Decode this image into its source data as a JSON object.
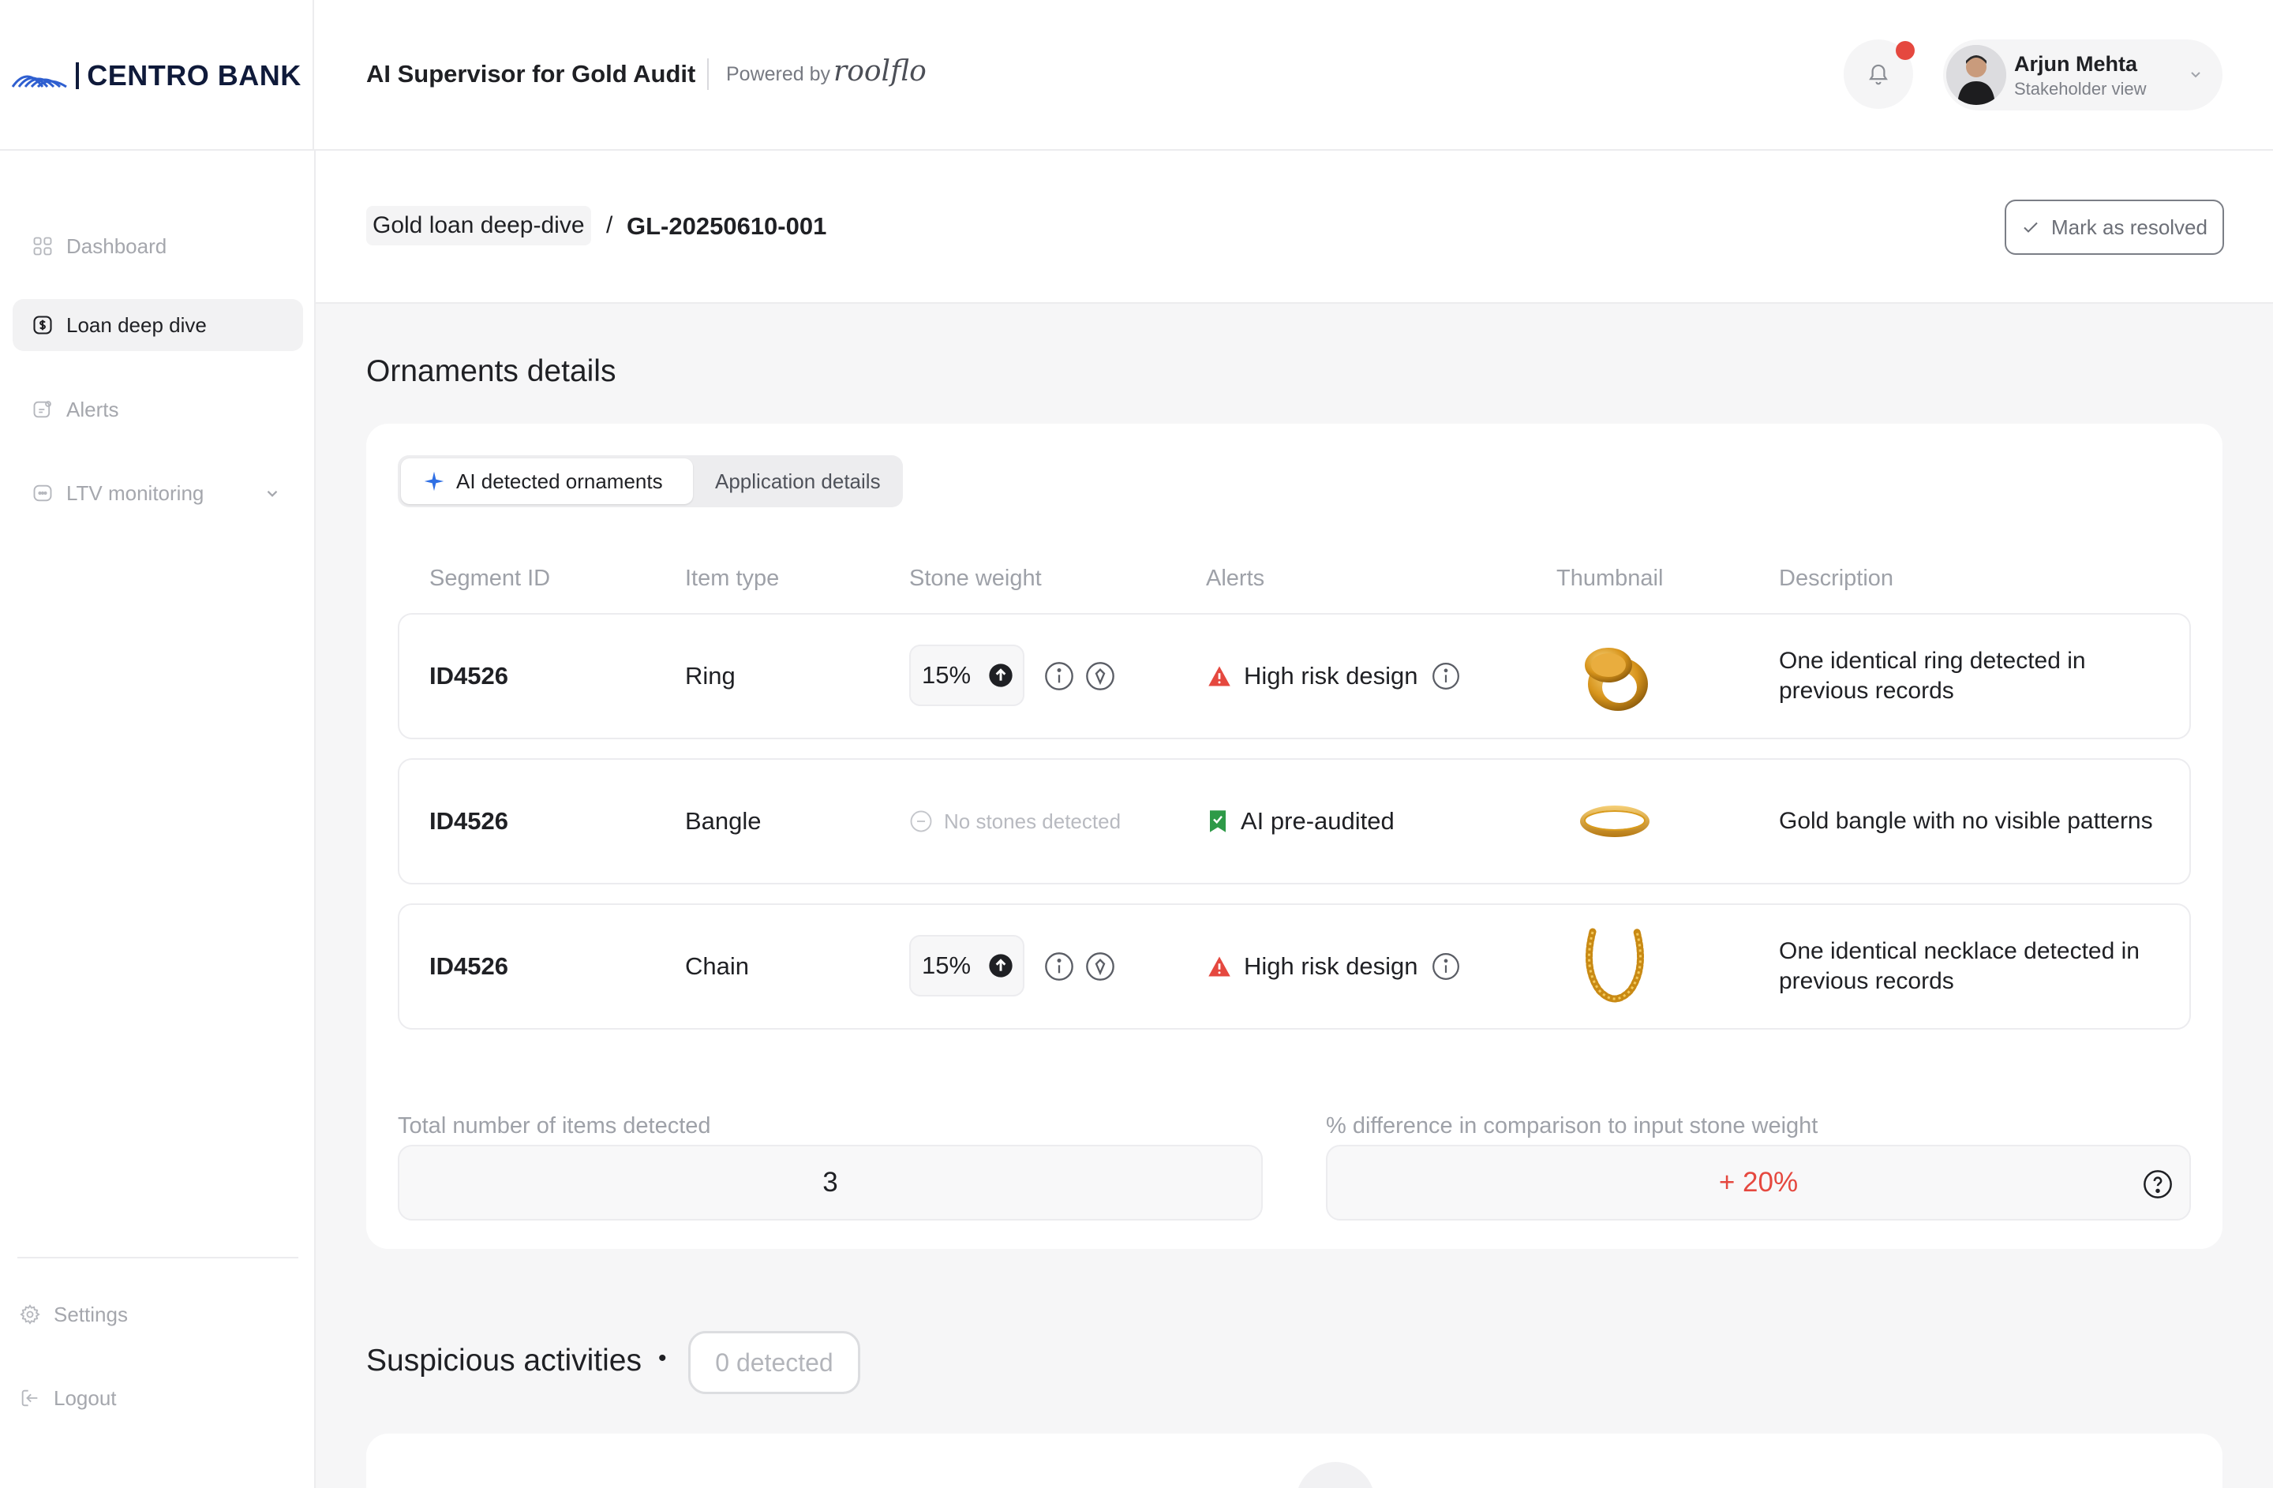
{
  "brand": {
    "name": "CENTRO BANK"
  },
  "header": {
    "app_title": "AI Supervisor for Gold Audit",
    "powered_by": "Powered by",
    "powered_logo": "roolflo",
    "user": {
      "name": "Arjun Mehta",
      "role": "Stakeholder view"
    }
  },
  "sidebar": {
    "items": [
      {
        "label": "Dashboard",
        "icon": "grid-icon"
      },
      {
        "label": "Loan deep dive",
        "icon": "dollar-icon",
        "active": true
      },
      {
        "label": "Alerts",
        "icon": "bell-dot-icon"
      },
      {
        "label": "LTV monitoring",
        "icon": "gauge-icon"
      }
    ],
    "settings_label": "Settings",
    "logout_label": "Logout"
  },
  "breadcrumb": {
    "parent": "Gold loan deep-dive",
    "separator": "/",
    "current": "GL-20250610-001"
  },
  "actions": {
    "mark_resolved": "Mark as resolved"
  },
  "ornaments": {
    "title": "Ornaments details",
    "tabs": [
      {
        "label": "AI detected ornaments",
        "active": true
      },
      {
        "label": "Application details",
        "active": false
      }
    ],
    "columns": [
      "Segment ID",
      "Item type",
      "Stone weight",
      "Alerts",
      "Thumbnail",
      "Description"
    ],
    "rows": [
      {
        "id": "ID4526",
        "type": "Ring",
        "stone": "15%",
        "alert": "High risk design",
        "alert_kind": "risk",
        "thumb": "ring",
        "description": "One identical ring detected in previous records"
      },
      {
        "id": "ID4526",
        "type": "Bangle",
        "stone": "No stones detected",
        "alert": "AI pre-audited",
        "alert_kind": "ok",
        "thumb": "bangle",
        "description": "Gold bangle with no visible patterns"
      },
      {
        "id": "ID4526",
        "type": "Chain",
        "stone": "15%",
        "alert": "High risk design",
        "alert_kind": "risk",
        "thumb": "chain",
        "description": "One identical necklace detected in previous records"
      }
    ],
    "stats": {
      "total_label": "Total number of items detected",
      "total_value": "3",
      "diff_label": "% difference in comparison to input stone weight",
      "diff_value": "+ 20%"
    }
  },
  "suspicious": {
    "title": "Suspicious activities",
    "bullet": "•",
    "badge": "0 detected"
  },
  "colors": {
    "risk": "#e5483f",
    "ok": "#2e9a48",
    "gold": "#d99b1c"
  }
}
